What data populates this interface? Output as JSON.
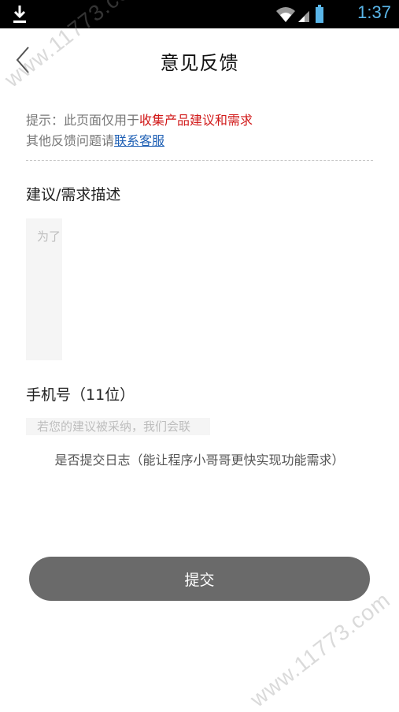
{
  "status_bar": {
    "time": "1:37",
    "icons": [
      "download-icon",
      "wifi-icon",
      "signal-icon",
      "battery-icon"
    ]
  },
  "nav": {
    "title": "意见反馈",
    "back_icon": "chevron-left-icon"
  },
  "tip": {
    "line1_prefix": "提示：此页面仅用于",
    "line1_highlight": "收集产品建议和需求",
    "line2_prefix": "其他反馈问题请",
    "line2_link": "联系客服"
  },
  "description": {
    "label": "建议/需求描述",
    "placeholder": "为了"
  },
  "phone": {
    "label": "手机号（11位）",
    "placeholder": "若您的建议被采纳，我们会联"
  },
  "log_option": "是否提交日志（能让程序小哥哥更快实现功能需求）",
  "submit_label": "提交",
  "watermark": "www.11773.com",
  "colors": {
    "status_time": "#5ab6e9",
    "highlight_red": "#d11a1a",
    "link_blue": "#1e5fb4",
    "submit_bg": "#6a6a6a"
  }
}
